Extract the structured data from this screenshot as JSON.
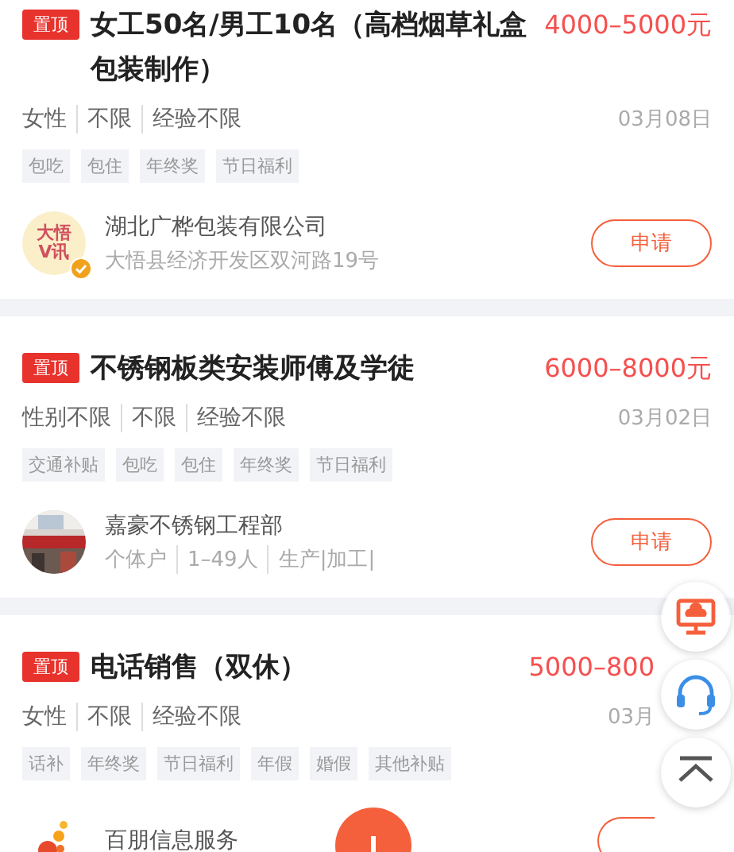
{
  "jobs": [
    {
      "badge": "置顶",
      "title": "女工50名/男工10名（高档烟草礼盒包装制作）",
      "salary": "4000–5000元",
      "meta": [
        "女性",
        "不限",
        "经验不限"
      ],
      "date": "03月08日",
      "tags": [
        "包吃",
        "包住",
        "年终奖",
        "节日福利"
      ],
      "company": {
        "name": "湖北广桦包装有限公司",
        "info": [
          "大悟县经济开发区双河路19号"
        ],
        "logo": {
          "kind": "seal",
          "text": "大悟V讯"
        },
        "verified": true
      },
      "apply": "申请"
    },
    {
      "badge": "置顶",
      "title": "不锈钢板类安装师傅及学徒",
      "salary": "6000–8000元",
      "meta": [
        "性别不限",
        "不限",
        "经验不限"
      ],
      "date": "03月02日",
      "tags": [
        "交通补贴",
        "包吃",
        "包住",
        "年终奖",
        "节日福利"
      ],
      "company": {
        "name": "嘉豪不锈钢工程部",
        "info": [
          "个体户",
          "1–49人",
          "生产|加工|"
        ],
        "logo": {
          "kind": "picture"
        },
        "verified": false
      },
      "apply": "申请"
    },
    {
      "badge": "置顶",
      "title": "电话销售（双休）",
      "salary": "5000–800",
      "meta": [
        "女性",
        "不限",
        "经验不限"
      ],
      "date": "03月",
      "tags": [
        "话补",
        "年终奖",
        "节日福利",
        "年假",
        "婚假",
        "其他补贴"
      ],
      "company": {
        "name": "百朋信息服务",
        "logo": {
          "kind": "drops"
        },
        "verified": false
      }
    }
  ],
  "float_buttons": [
    {
      "kind": "monitor"
    },
    {
      "kind": "headset"
    },
    {
      "kind": "top"
    }
  ],
  "add_button": {
    "kind": "plus"
  }
}
